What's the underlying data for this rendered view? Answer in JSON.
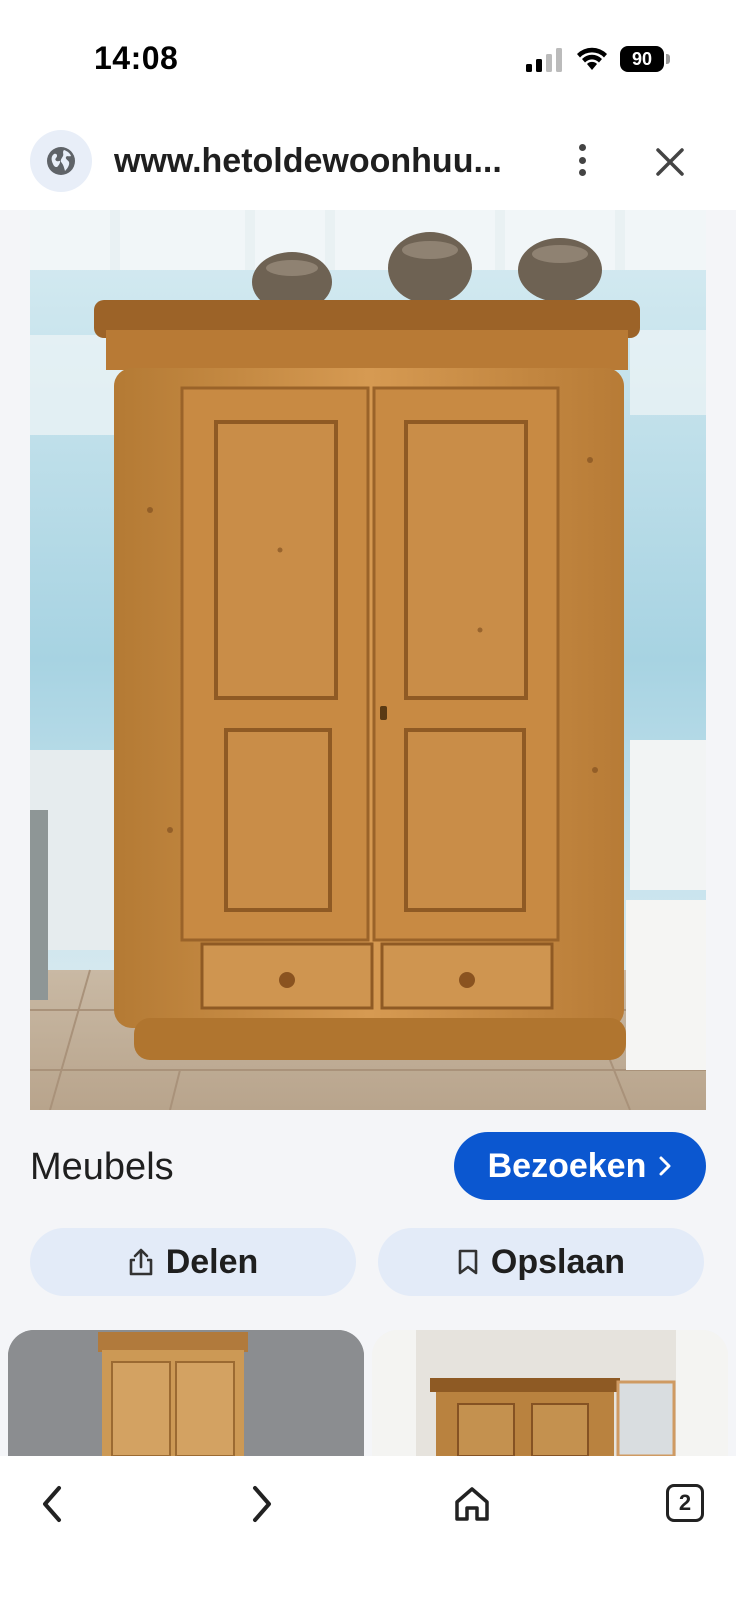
{
  "status_bar": {
    "time": "14:08",
    "battery": "90"
  },
  "url_bar": {
    "url": "www.hetoldewoonhuu..."
  },
  "result": {
    "title": "Meubels",
    "visit_label": "Bezoeken",
    "share_label": "Delen",
    "save_label": "Opslaan"
  },
  "bottom_nav": {
    "tab_count": "2"
  },
  "icons": {
    "globe": "globe-icon",
    "more": "more-vert-icon",
    "close": "close-icon",
    "share": "share-icon",
    "bookmark": "bookmark-icon",
    "back": "chevron-left-icon",
    "forward": "chevron-right-icon",
    "home": "home-icon"
  },
  "colors": {
    "accent": "#0b57d0",
    "chip_bg": "#e3ebf8",
    "wood": "#c98f45"
  }
}
